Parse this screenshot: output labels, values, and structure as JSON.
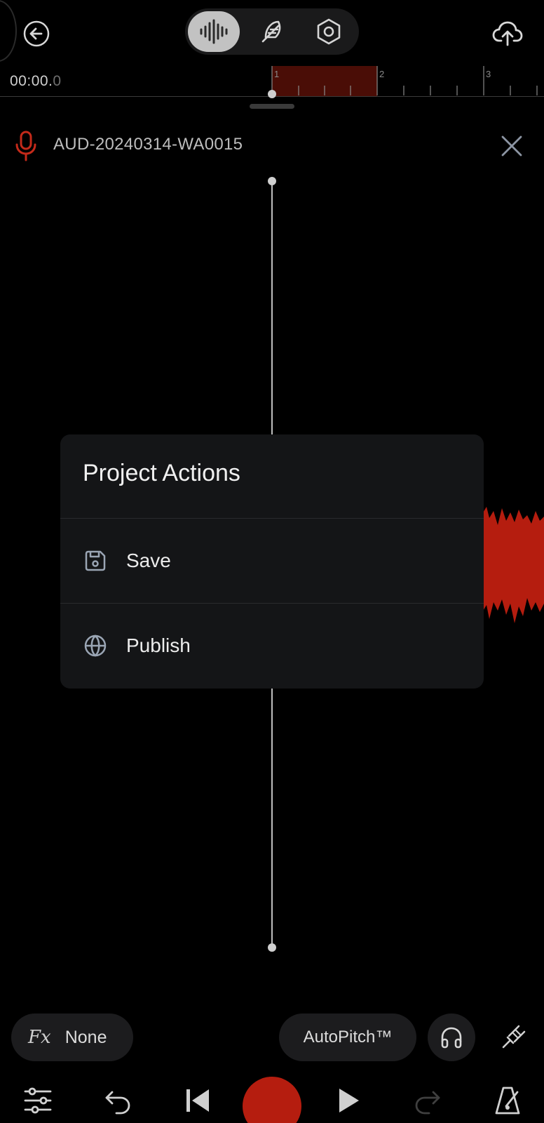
{
  "colors": {
    "accent_red": "#b51d0f",
    "background": "#000000",
    "dialog_bg": "#141517",
    "pill_bg": "#1c1c1e"
  },
  "header": {
    "back_icon": "back-arrow-icon",
    "modes": [
      {
        "icon": "waveform-icon",
        "active": true
      },
      {
        "icon": "feather-icon",
        "active": false
      },
      {
        "icon": "hexagon-settings-icon",
        "active": false
      }
    ],
    "upload_icon": "cloud-upload-icon"
  },
  "timeline": {
    "time_main": "00:00.",
    "time_fraction": "0",
    "bar_labels": [
      "1",
      "2",
      "3"
    ]
  },
  "track": {
    "icon": "microphone-icon",
    "name": "AUD-20240314-WA0015",
    "close_icon": "close-icon"
  },
  "dialog": {
    "title": "Project Actions",
    "items": [
      {
        "label": "Save",
        "icon": "floppy-save-icon"
      },
      {
        "label": "Publish",
        "icon": "globe-icon"
      }
    ]
  },
  "controls": {
    "fx_label": "Fx",
    "fx_value": "None",
    "autopitch_label": "AutoPitch™",
    "headphones_icon": "headphones-icon",
    "tuning_icon": "tuning-fork-icon"
  },
  "transport": {
    "mixer_icon": "mixer-sliders-icon",
    "undo_icon": "undo-icon",
    "skip_back_icon": "skip-to-start-icon",
    "record_icon": "record-icon",
    "play_icon": "play-icon",
    "redo_icon": "redo-icon",
    "metronome_icon": "metronome-icon"
  }
}
